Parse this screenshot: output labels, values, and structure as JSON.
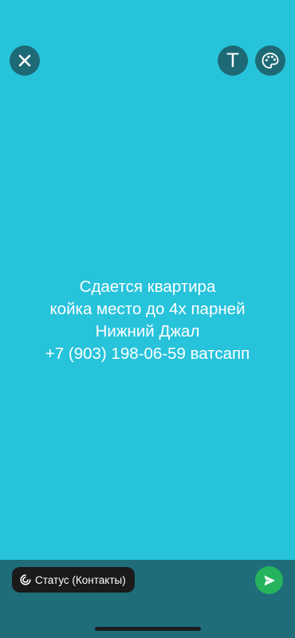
{
  "header": {
    "close_icon": "close-icon",
    "text_button_label": "T",
    "palette_icon": "palette-icon"
  },
  "status": {
    "lines": [
      "Сдается квартира",
      "койка место до 4х парней",
      "Нижний Джал",
      "+7 (903) 198-06-59 ватсапп"
    ],
    "background_color": "#27c3db"
  },
  "footer": {
    "audience_label": "Статус (Контакты)",
    "audience_icon": "status-ring-icon",
    "send_icon": "send-icon",
    "send_color": "#25b35e"
  }
}
